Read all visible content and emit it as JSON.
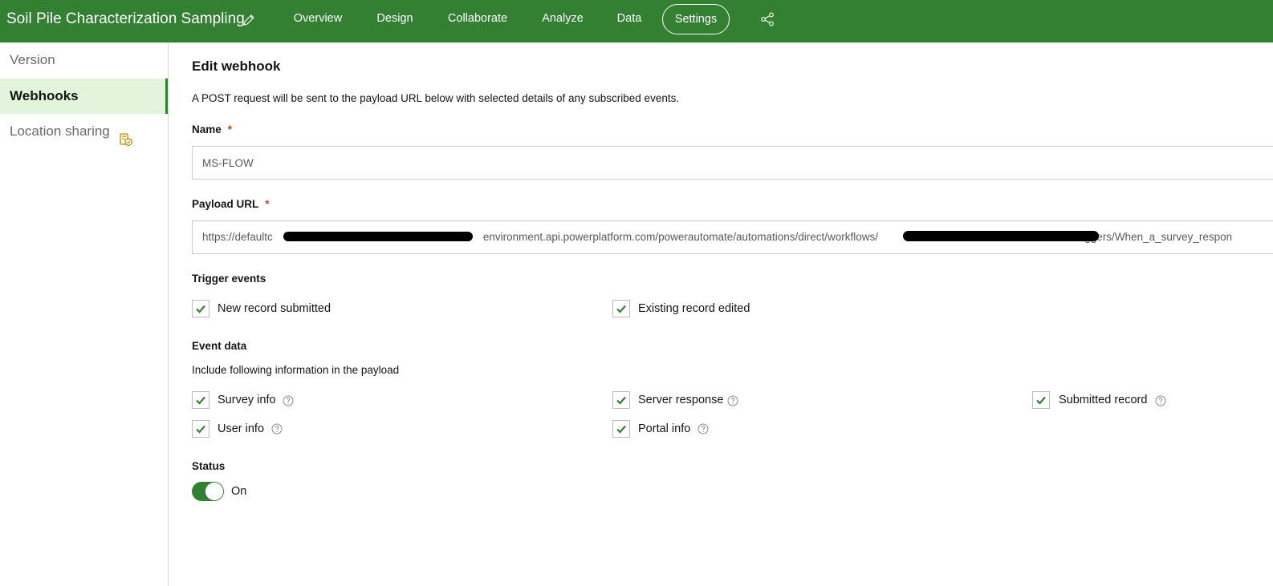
{
  "app": {
    "title": "Soil Pile Characterization Sampling"
  },
  "nav": {
    "tabs": [
      {
        "label": "Overview"
      },
      {
        "label": "Design"
      },
      {
        "label": "Collaborate"
      },
      {
        "label": "Analyze"
      },
      {
        "label": "Data"
      },
      {
        "label": "Settings",
        "active": true
      }
    ]
  },
  "sidebar": {
    "items": [
      {
        "label": "Version"
      },
      {
        "label": "Webhooks",
        "active": true
      },
      {
        "label": "Location sharing"
      }
    ]
  },
  "form": {
    "heading": "Edit webhook",
    "description": "A POST request will be sent to the payload URL below with selected details of any subscribed events.",
    "name_label": "Name",
    "required_mark": "*",
    "name_value": "MS-FLOW",
    "payload_label": "Payload URL",
    "payload_url": {
      "part1": "https://defaultc",
      "part2": "environment.api.powerplatform.com/powerautomate/automations/direct/workflows/",
      "part3": "triggers/When_a_survey_respon"
    },
    "trigger_events_label": "Trigger events",
    "trigger_events": [
      {
        "label": "New record submitted",
        "checked": true
      },
      {
        "label": "Existing record edited",
        "checked": true
      }
    ],
    "event_data_label": "Event data",
    "event_data_desc": "Include following information in the payload",
    "event_data": [
      {
        "label": "Survey info",
        "checked": true
      },
      {
        "label": "Server response",
        "checked": true
      },
      {
        "label": "Submitted record",
        "checked": true
      },
      {
        "label": "User info",
        "checked": true
      },
      {
        "label": "Portal info",
        "checked": true
      }
    ],
    "status_label": "Status",
    "status_value": "On",
    "status_on": true
  },
  "colors": {
    "brand_green": "#338033",
    "active_sidebar_bg": "#e2f5dc",
    "required_red": "#c2461e",
    "location_icon": "#c58b00"
  },
  "icons": {
    "title_edit": "pencil-icon",
    "share": "share-icon",
    "location_sharing": "location-shield-icon",
    "checkbox": "check-icon",
    "help": "question-circle-icon"
  }
}
